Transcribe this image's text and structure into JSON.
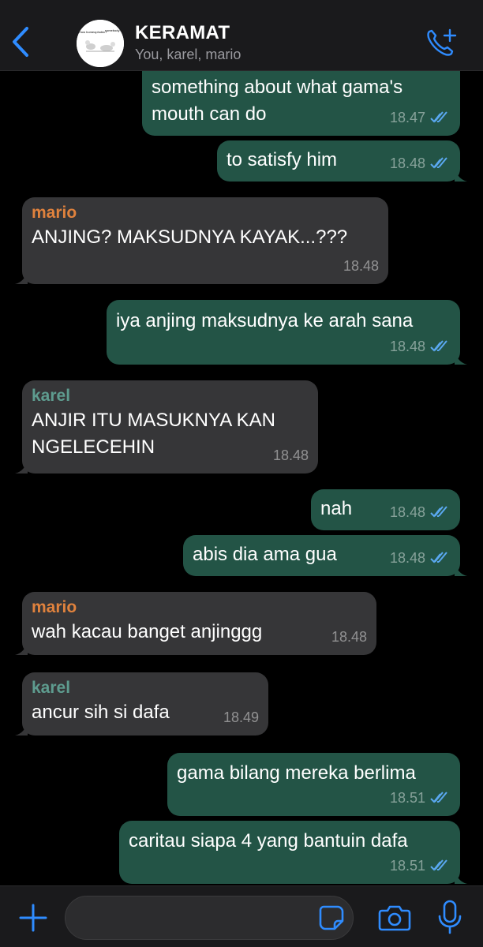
{
  "header": {
    "title": "KERAMAT",
    "subtitle": "You, karel, mario",
    "avatar_text_left": "How homeophobic?",
    "avatar_text_right": "somebody:"
  },
  "messages": [
    {
      "id": "m1",
      "direction": "out",
      "text": "something about what gama's\nmouth can do",
      "time": "18.47",
      "read": true
    },
    {
      "id": "m2",
      "direction": "out",
      "text": "to satisfy him",
      "time": "18.48",
      "read": true
    },
    {
      "id": "m3",
      "direction": "in",
      "sender": "mario",
      "text": "ANJING? MAKSUDNYA KAYAK...???",
      "time": "18.48"
    },
    {
      "id": "m4",
      "direction": "out",
      "text": "iya anjing maksudnya ke arah sana",
      "time": "18.48",
      "read": true
    },
    {
      "id": "m5",
      "direction": "in",
      "sender": "karel",
      "text": "ANJIR ITU MASUKNYA KAN\nNGELECEHIN",
      "time": "18.48"
    },
    {
      "id": "m6",
      "direction": "out",
      "text": "nah",
      "time": "18.48",
      "read": true
    },
    {
      "id": "m7",
      "direction": "out",
      "text": "abis dia ama gua",
      "time": "18.48",
      "read": true
    },
    {
      "id": "m8",
      "direction": "in",
      "sender": "mario",
      "text": "wah kacau banget anjinggg",
      "time": "18.48"
    },
    {
      "id": "m9",
      "direction": "in",
      "sender": "karel",
      "text": "ancur sih si dafa",
      "time": "18.49"
    },
    {
      "id": "m10",
      "direction": "out",
      "text": "gama bilang mereka berlima",
      "time": "18.51",
      "read": true
    },
    {
      "id": "m11",
      "direction": "out",
      "text": "caritau siapa 4 yang bantuin dafa",
      "time": "18.51",
      "read": true
    }
  ],
  "composer": {
    "value": "",
    "placeholder": ""
  },
  "colors": {
    "accent": "#2f8cff",
    "outgoing_bubble": "#235446",
    "incoming_bubble": "#363638",
    "sender_mario": "#e0823d",
    "sender_karel": "#5e9c8f",
    "read_ticks": "#5aa8f0"
  },
  "icons": [
    "back-chevron-icon",
    "add-call-icon",
    "plus-icon",
    "sticker-icon",
    "camera-icon",
    "microphone-icon",
    "double-check-icon"
  ]
}
